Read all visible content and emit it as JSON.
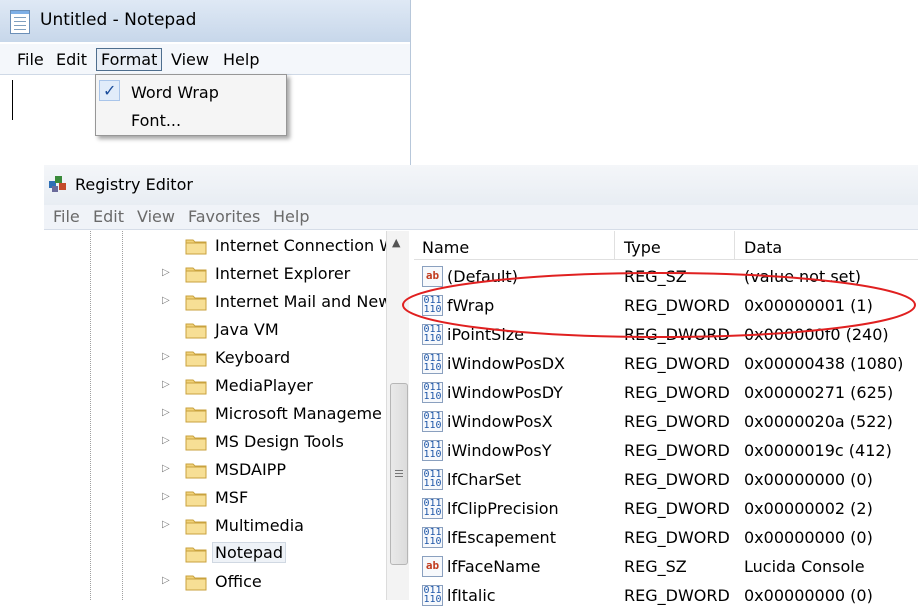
{
  "notepad": {
    "title": "Untitled - Notepad",
    "menu": [
      "File",
      "Edit",
      "Format",
      "View",
      "Help"
    ],
    "active_menu": "Format",
    "format_dropdown": [
      {
        "label": "Word Wrap",
        "checked": true
      },
      {
        "label": "Font...",
        "checked": false
      }
    ],
    "check_glyph": "✓"
  },
  "registry": {
    "title": "Registry Editor",
    "menu": [
      "File",
      "Edit",
      "View",
      "Favorites",
      "Help"
    ],
    "tree": [
      {
        "label": "Internet Connection W",
        "expandable": false
      },
      {
        "label": "Internet Explorer",
        "expandable": true
      },
      {
        "label": "Internet Mail and New",
        "expandable": true
      },
      {
        "label": "Java VM",
        "expandable": false
      },
      {
        "label": "Keyboard",
        "expandable": true
      },
      {
        "label": "MediaPlayer",
        "expandable": true
      },
      {
        "label": "Microsoft Manageme",
        "expandable": true
      },
      {
        "label": "MS Design Tools",
        "expandable": true
      },
      {
        "label": "MSDAIPP",
        "expandable": true
      },
      {
        "label": "MSF",
        "expandable": true
      },
      {
        "label": "Multimedia",
        "expandable": true
      },
      {
        "label": "Notepad",
        "expandable": false,
        "selected": true
      },
      {
        "label": "Office",
        "expandable": true
      }
    ],
    "columns": {
      "name": "Name",
      "type": "Type",
      "data": "Data"
    },
    "values": [
      {
        "name": "(Default)",
        "type": "REG_SZ",
        "data": "(value not set)",
        "icon": "ab"
      },
      {
        "name": "fWrap",
        "type": "REG_DWORD",
        "data": "0x00000001 (1)",
        "icon": "dword"
      },
      {
        "name": "iPointSize",
        "type": "REG_DWORD",
        "data": "0x000000f0 (240)",
        "icon": "dword"
      },
      {
        "name": "iWindowPosDX",
        "type": "REG_DWORD",
        "data": "0x00000438 (1080)",
        "icon": "dword"
      },
      {
        "name": "iWindowPosDY",
        "type": "REG_DWORD",
        "data": "0x00000271 (625)",
        "icon": "dword"
      },
      {
        "name": "iWindowPosX",
        "type": "REG_DWORD",
        "data": "0x0000020a (522)",
        "icon": "dword"
      },
      {
        "name": "iWindowPosY",
        "type": "REG_DWORD",
        "data": "0x0000019c (412)",
        "icon": "dword"
      },
      {
        "name": "lfCharSet",
        "type": "REG_DWORD",
        "data": "0x00000000 (0)",
        "icon": "dword"
      },
      {
        "name": "lfClipPrecision",
        "type": "REG_DWORD",
        "data": "0x00000002 (2)",
        "icon": "dword"
      },
      {
        "name": "lfEscapement",
        "type": "REG_DWORD",
        "data": "0x00000000 (0)",
        "icon": "dword"
      },
      {
        "name": "lfFaceName",
        "type": "REG_SZ",
        "data": "Lucida Console",
        "icon": "ab"
      },
      {
        "name": "lfItalic",
        "type": "REG_DWORD",
        "data": "0x00000000 (0)",
        "icon": "dword"
      }
    ],
    "highlighted_value": "fWrap",
    "annotation_color": "#e02020"
  }
}
